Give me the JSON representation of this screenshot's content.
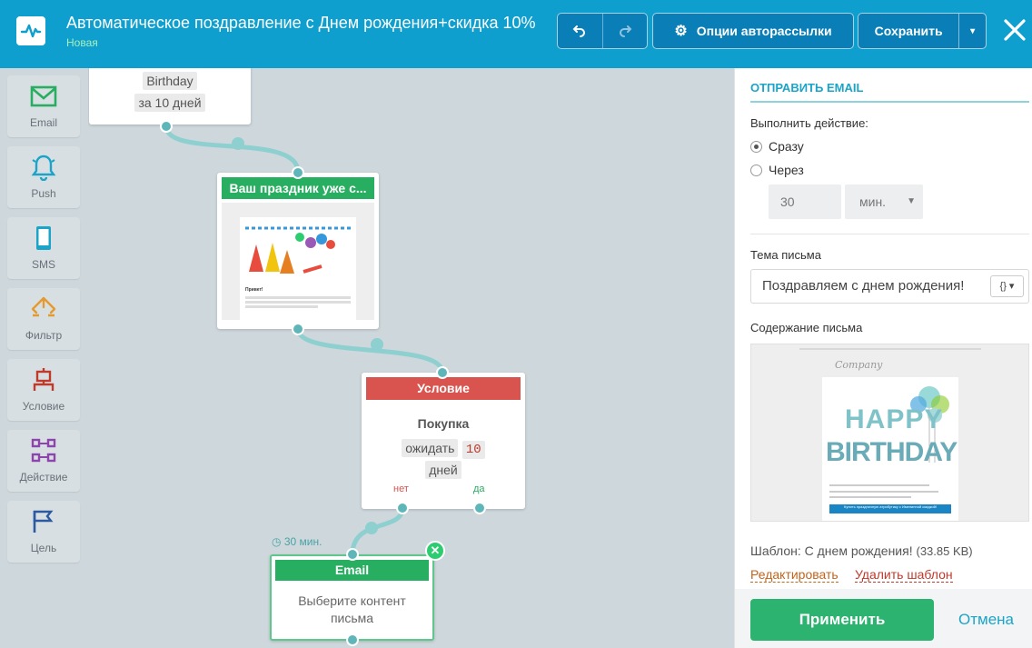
{
  "header": {
    "title": "Автоматическое поздравление с Днем рождения+скидка 10%",
    "status": "Новая",
    "options_label": "Опции авторассылки",
    "save_label": "Сохранить",
    "undo_icon": "undo-icon",
    "redo_icon": "redo-icon",
    "close_icon": "close-icon",
    "gear_icon": "gear-icon"
  },
  "sidebar": {
    "items": [
      {
        "label": "Email",
        "icon": "envelope-icon"
      },
      {
        "label": "Push",
        "icon": "bell-icon"
      },
      {
        "label": "SMS",
        "icon": "phone-icon"
      },
      {
        "label": "Фильтр",
        "icon": "filter-icon"
      },
      {
        "label": "Условие",
        "icon": "condition-icon"
      },
      {
        "label": "Действие",
        "icon": "action-icon"
      },
      {
        "label": "Цель",
        "icon": "flag-icon"
      }
    ]
  },
  "canvas": {
    "start": {
      "label": "Birthday",
      "offset": "за 10 дней"
    },
    "email1": {
      "title": "Ваш праздник уже с...",
      "preview_heading": "Привет!"
    },
    "condition": {
      "title": "Условие",
      "name": "Покупка",
      "wait": "ожидать",
      "wait_value": "10",
      "unit": "дней",
      "no": "нет",
      "yes": "да"
    },
    "delay": "30 мин.",
    "email2": {
      "title": "Email",
      "body": "Выберите контент письма"
    }
  },
  "panel": {
    "section_title": "ОТПРАВИТЬ EMAIL",
    "action_label": "Выполнить действие:",
    "option_now": "Сразу",
    "option_after": "Через",
    "delay_value": "30",
    "delay_unit": "мин.",
    "subject_label": "Тема письма",
    "subject_value": "Поздравляем с днем рождения!",
    "content_label": "Содержание письма",
    "preview_company": "Company",
    "preview_happy": "HAPPY",
    "preview_birthday": "BIRTHDAY",
    "preview_button": "Купить праздничную атрибутику с Именинной скидкой!",
    "template_info": "Шаблон: С днем рождения!",
    "template_size": "(33.85 KB)",
    "edit_link": "Редактировать",
    "delete_link": "Удалить шаблон",
    "apply_label": "Применить",
    "cancel_label": "Отмена"
  },
  "colors": {
    "topbar": "#0e9fce",
    "green": "#27ae60",
    "red": "#d9534f",
    "teal": "#5fb6b8",
    "accent": "#1ba4c7"
  }
}
